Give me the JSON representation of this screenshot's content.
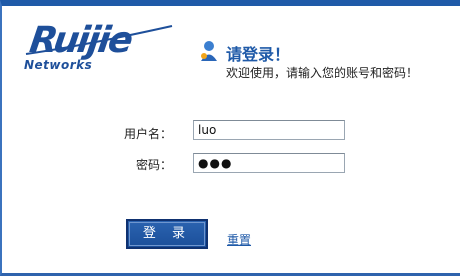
{
  "brand": {
    "name": "Ruijie",
    "tagline": "Networks"
  },
  "welcome": {
    "title": "请登录！",
    "subtitle": "欢迎使用，请输入您的账号和密码！"
  },
  "form": {
    "username_label": "用户名：",
    "username_value": "luo",
    "password_label": "密码：",
    "password_value": "●●●"
  },
  "actions": {
    "login_label": "登 录",
    "reset_label": "重置"
  },
  "colors": {
    "brand_blue": "#1e4f9a",
    "accent_blue": "#1f5aa8"
  },
  "icons": {
    "welcome": "user-icon"
  }
}
